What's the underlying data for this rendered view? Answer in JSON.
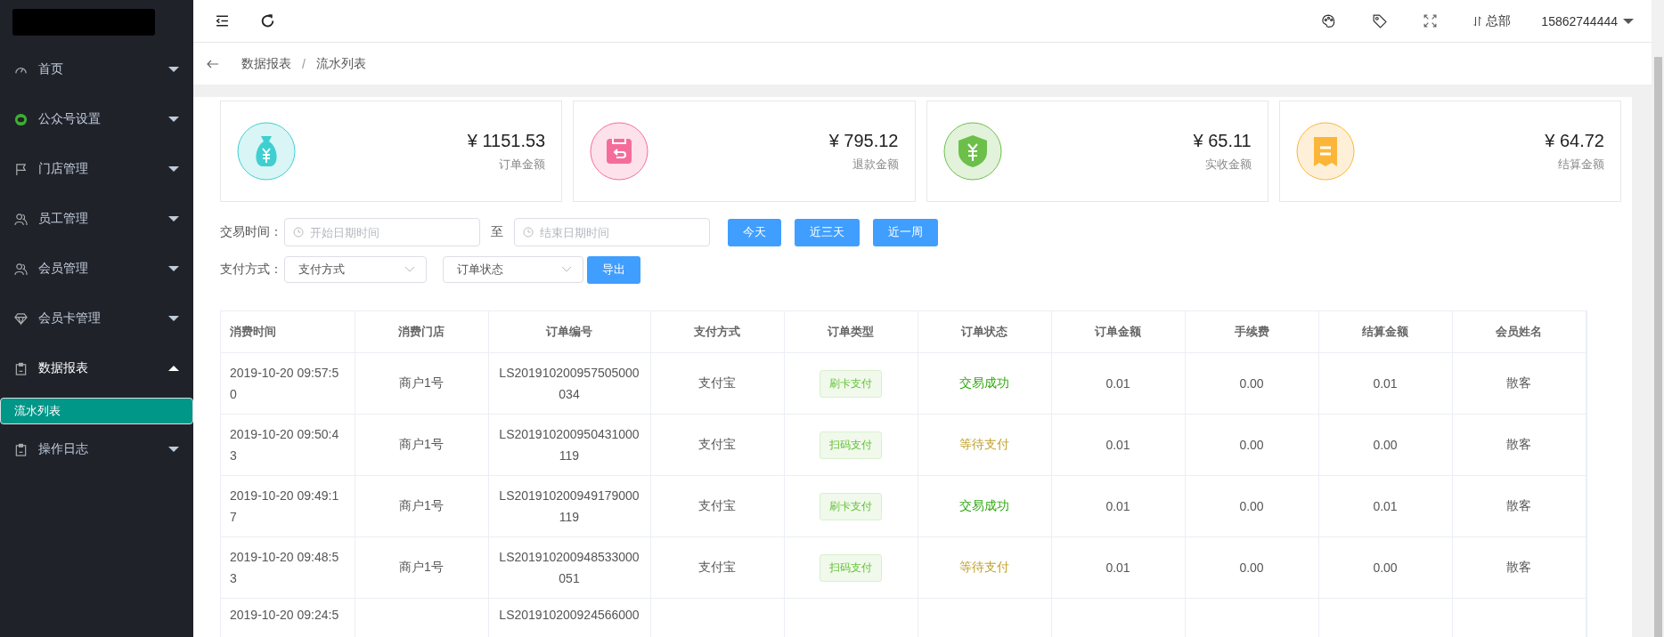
{
  "sidebar": {
    "items": [
      {
        "label": "首页",
        "expanded": false
      },
      {
        "label": "公众号设置",
        "expanded": false
      },
      {
        "label": "门店管理",
        "expanded": false
      },
      {
        "label": "员工管理",
        "expanded": false
      },
      {
        "label": "会员管理",
        "expanded": false
      },
      {
        "label": "会员卡管理",
        "expanded": false
      },
      {
        "label": "数据报表",
        "expanded": true,
        "children": [
          {
            "label": "流水列表",
            "selected": true
          }
        ]
      },
      {
        "label": "操作日志",
        "expanded": false
      }
    ]
  },
  "topbar": {
    "branch": "总部",
    "user": "15862744444"
  },
  "breadcrumb": {
    "items": [
      "数据报表",
      "流水列表"
    ],
    "separator": "/"
  },
  "cards": [
    {
      "color": "#3fcfd0",
      "amount": "¥ 1151.53",
      "label": "订单金额"
    },
    {
      "color": "#f56c9a",
      "amount": "¥ 795.12",
      "label": "退款金额"
    },
    {
      "color": "#6cc04a",
      "amount": "¥ 65.11",
      "label": "实收金额"
    },
    {
      "color": "#fbb63a",
      "amount": "¥ 64.72",
      "label": "结算金额"
    }
  ],
  "filters": {
    "time_label": "交易时间：",
    "start_placeholder": "开始日期时间",
    "to": "至",
    "end_placeholder": "结束日期时间",
    "quick_buttons": [
      "今天",
      "近三天",
      "近一周"
    ],
    "pay_label": "支付方式：",
    "pay_select": "支付方式",
    "status_select": "订单状态",
    "export": "导出"
  },
  "table": {
    "columns": [
      "消费时间",
      "消费门店",
      "订单编号",
      "支付方式",
      "订单类型",
      "订单状态",
      "订单金额",
      "手续费",
      "结算金额",
      "会员姓名"
    ],
    "rows": [
      {
        "time": "2019-10-20 09:57:50",
        "store": "商户1号",
        "order_no": "LS201910200957505000034",
        "pay": "支付宝",
        "type": "刷卡支付",
        "status": "交易成功",
        "kind": "success",
        "amount": "0.01",
        "fee": "0.00",
        "settle": "0.01",
        "member": "散客"
      },
      {
        "time": "2019-10-20 09:50:43",
        "store": "商户1号",
        "order_no": "LS201910200950431000119",
        "pay": "支付宝",
        "type": "扫码支付",
        "status": "等待支付",
        "kind": "pending",
        "amount": "0.01",
        "fee": "0.00",
        "settle": "0.00",
        "member": "散客"
      },
      {
        "time": "2019-10-20 09:49:17",
        "store": "商户1号",
        "order_no": "LS201910200949179000119",
        "pay": "支付宝",
        "type": "刷卡支付",
        "status": "交易成功",
        "kind": "success",
        "amount": "0.01",
        "fee": "0.00",
        "settle": "0.01",
        "member": "散客"
      },
      {
        "time": "2019-10-20 09:48:53",
        "store": "商户1号",
        "order_no": "LS201910200948533000051",
        "pay": "支付宝",
        "type": "扫码支付",
        "status": "等待支付",
        "kind": "pending",
        "amount": "0.01",
        "fee": "0.00",
        "settle": "0.00",
        "member": "散客"
      },
      {
        "time": "2019-10-20 09:24:5",
        "order_no": "LS201910200924566000"
      }
    ]
  }
}
